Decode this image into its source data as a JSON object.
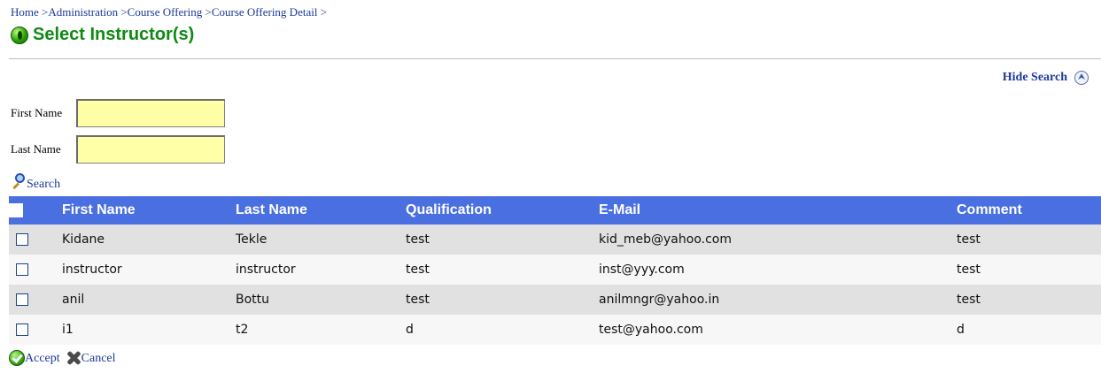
{
  "breadcrumb": "Home >Administration >Course Offering >Course Offering Detail >",
  "page_title": "Select Instructor(s)",
  "search_panel": {
    "toggle_label": "Hide Search",
    "first_name_label": "First Name",
    "first_name_value": "",
    "last_name_label": "Last Name",
    "last_name_value": "",
    "search_label": "Search"
  },
  "table": {
    "columns": [
      "First Name",
      "Last Name",
      "Qualification",
      "E-Mail",
      "Comment"
    ],
    "rows": [
      {
        "first": "Kidane",
        "last": "Tekle",
        "qualification": "test",
        "email": "kid_meb@yahoo.com",
        "comment": "test",
        "checked": false
      },
      {
        "first": "instructor",
        "last": "instructor",
        "qualification": "test",
        "email": "inst@yyy.com",
        "comment": "test",
        "checked": false
      },
      {
        "first": "anil",
        "last": "Bottu",
        "qualification": "test",
        "email": "anilmngr@yahoo.in",
        "comment": "test",
        "checked": false
      },
      {
        "first": "i1",
        "last": "t2",
        "qualification": "d",
        "email": "test@yahoo.com",
        "comment": "d",
        "checked": false
      }
    ]
  },
  "actions": {
    "accept_label": "Accept",
    "cancel_label": "Cancel"
  },
  "colors": {
    "header_bg": "#4a6fe0",
    "title_green": "#0f8a12",
    "link_blue": "#1b3a9a",
    "input_bg": "#ffffa8",
    "row_odd": "#e1e1e1",
    "row_even": "#f7f7f7"
  },
  "icons": {
    "title": "green-circle-icon",
    "collapse": "double-chevron-up-icon",
    "search": "magnifier-icon",
    "accept": "green-check-icon",
    "cancel": "x-icon"
  }
}
